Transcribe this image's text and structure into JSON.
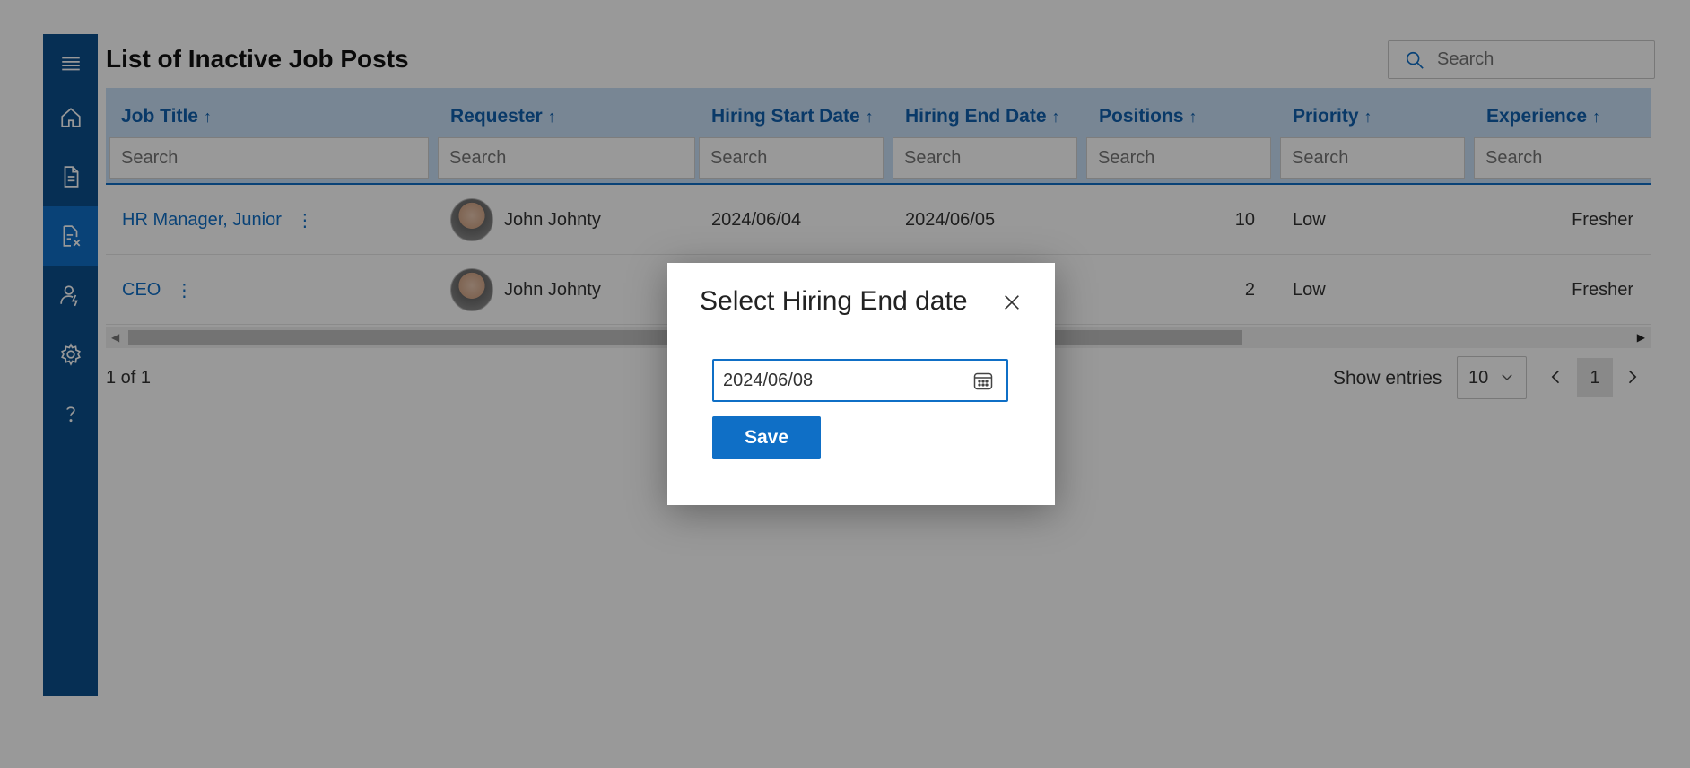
{
  "page": {
    "title": "List of Inactive Job Posts"
  },
  "search": {
    "placeholder": "Search"
  },
  "sidebar": {
    "items": [
      {
        "icon": "menu-icon"
      },
      {
        "icon": "home-icon"
      },
      {
        "icon": "document-icon"
      },
      {
        "icon": "inactive-job-icon",
        "active": true
      },
      {
        "icon": "user-settings-icon"
      },
      {
        "icon": "gear-icon"
      },
      {
        "icon": "help-icon"
      }
    ]
  },
  "grid": {
    "columns": [
      {
        "label": "Job Title",
        "sort": "↑"
      },
      {
        "label": "Requester",
        "sort": "↑"
      },
      {
        "label": "Hiring Start Date",
        "sort": "↑"
      },
      {
        "label": "Hiring End Date",
        "sort": "↑"
      },
      {
        "label": "Positions",
        "sort": "↑"
      },
      {
        "label": "Priority",
        "sort": "↑"
      },
      {
        "label": "Experience",
        "sort": "↑"
      }
    ],
    "filter_placeholder": "Search",
    "rows": [
      {
        "job_title": "HR Manager, Junior",
        "requester": "John Johnty",
        "start": "2024/06/04",
        "end": "2024/06/05",
        "positions": "10",
        "priority": "Low",
        "experience": "Fresher"
      },
      {
        "job_title": "CEO",
        "requester": "John Johnty",
        "start": "",
        "end": "",
        "positions": "2",
        "priority": "Low",
        "experience": "Fresher"
      }
    ]
  },
  "pager": {
    "count_text": "1 of 1",
    "show_entries_label": "Show entries",
    "entries_value": "10",
    "current_page": "1"
  },
  "dialog": {
    "title": "Select Hiring End date",
    "date_value": "2024/06/08",
    "save_label": "Save"
  },
  "colors": {
    "sidebar": "#0a4f8c",
    "accent": "#0f6fc6",
    "header_bg": "#c8e0f7"
  }
}
